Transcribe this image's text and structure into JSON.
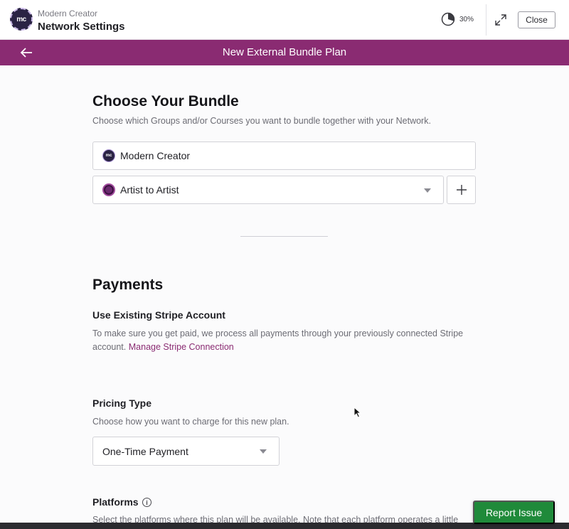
{
  "header": {
    "org_name": "Modern Creator",
    "page_name": "Network Settings",
    "logo_text": "mc",
    "progress_label": "30%",
    "progress_value": 0.3,
    "close_label": "Close"
  },
  "titlebar": {
    "title": "New External Bundle Plan"
  },
  "bundle": {
    "heading": "Choose Your Bundle",
    "description": "Choose which Groups and/or Courses you want to bundle together with your Network.",
    "network_field": "Modern Creator",
    "group_select": "Artist to Artist",
    "add_label": "+"
  },
  "payments": {
    "heading": "Payments",
    "stripe_heading": "Use Existing Stripe Account",
    "stripe_desc_line1": "To make sure you get paid, we process all payments through your previously connected Stripe",
    "stripe_desc_line2": "account.",
    "stripe_link": "Manage Stripe Connection",
    "pricing_heading": "Pricing Type",
    "pricing_desc": "Choose how you want to charge for this new plan.",
    "pricing_select": "One-Time Payment",
    "platforms_heading": "Platforms",
    "platforms_desc": "Select the platforms where this plan will be available. Note that each platform operates a little"
  },
  "footer": {
    "report_label": "Report Issue"
  },
  "colors": {
    "brand": "#8a2b72",
    "report": "#1f8a3a"
  },
  "icons": [
    "progress-pie-icon",
    "expand-icon",
    "back-arrow-icon",
    "chevron-down-icon",
    "plus-icon",
    "info-icon",
    "mouse-cursor-icon"
  ]
}
